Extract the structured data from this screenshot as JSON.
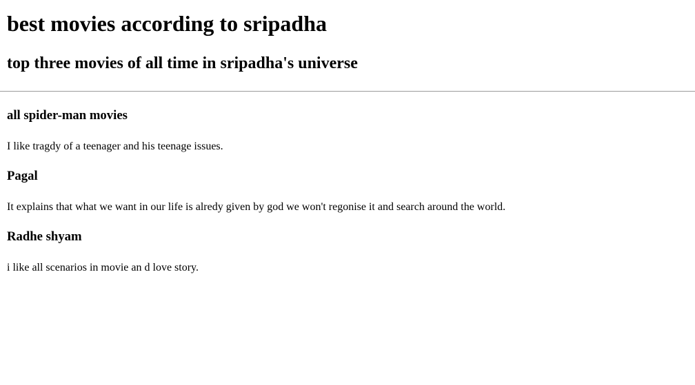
{
  "title": "best movies according to sripadha",
  "subtitle": "top three movies of all time in sripadha's universe",
  "movies": [
    {
      "name": "all spider-man movies",
      "description": "I like tragdy of a teenager and his teenage issues."
    },
    {
      "name": "Pagal",
      "description": "It explains that what we want in our life is alredy given by god we won't regonise it and search around the world."
    },
    {
      "name": "Radhe shyam",
      "description": "i like all scenarios in movie an d love story."
    }
  ]
}
